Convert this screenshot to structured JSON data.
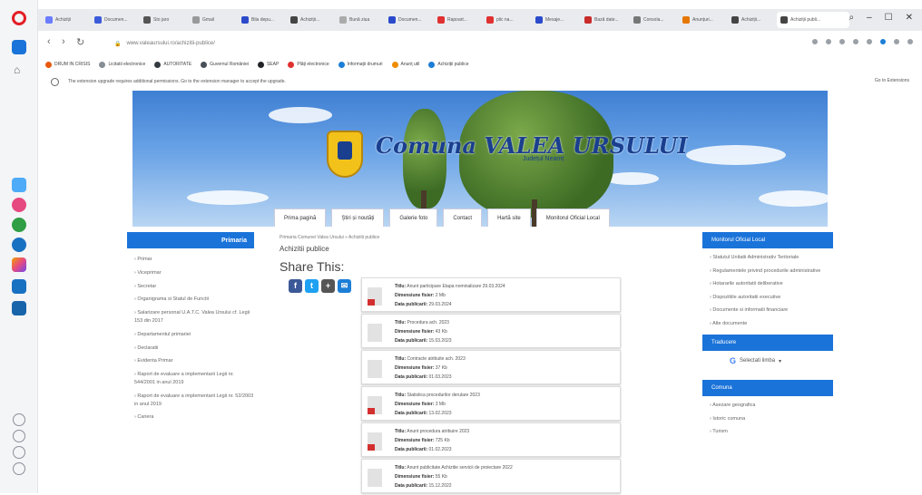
{
  "browser": {
    "tabs": [
      {
        "label": "Achiziții",
        "color": "#6b7cff"
      },
      {
        "label": "Documen...",
        "color": "#3b5bdb"
      },
      {
        "label": "Sto jaro",
        "color": "#555555"
      },
      {
        "label": "Gmail",
        "color": "#999999"
      },
      {
        "label": "Bila depu...",
        "color": "#2b4acb"
      },
      {
        "label": "Achiziții...",
        "color": "#444444"
      },
      {
        "label": "Bună ziua",
        "color": "#aaaaaa"
      },
      {
        "label": "Documen...",
        "color": "#2b4acb"
      },
      {
        "label": "Rapoart...",
        "color": "#e03131"
      },
      {
        "label": "plic na...",
        "color": "#e03131"
      },
      {
        "label": "Mesaje...",
        "color": "#2b4acb"
      },
      {
        "label": "Bază date...",
        "color": "#c92a2a"
      },
      {
        "label": "Consola...",
        "color": "#777777"
      },
      {
        "label": "Anunțuri...",
        "color": "#e67700"
      },
      {
        "label": "Achiziții...",
        "color": "#444444"
      },
      {
        "label": "Achiziții publi...",
        "color": "#444444",
        "active": true
      }
    ],
    "url": "www.valeaursului.ro/achizitii-publice/",
    "bookmarks": [
      {
        "label": "DRUM IN CRISIS",
        "color": "#e8590c"
      },
      {
        "label": "Licitatii electronice",
        "color": "#868e96"
      },
      {
        "label": "AUTORITATE",
        "color": "#343a40"
      },
      {
        "label": "Guvernul României",
        "color": "#495057"
      },
      {
        "label": "SEAP",
        "color": "#212529"
      },
      {
        "label": "Plăți electronice",
        "color": "#e03131"
      },
      {
        "label": "Informații drumuri",
        "color": "#1c7ed6"
      },
      {
        "label": "Anunț util",
        "color": "#f08c00"
      },
      {
        "label": "Achiziții publice",
        "color": "#1c7ed6"
      }
    ],
    "infobar_text": "The extension upgrade requires additional permissions. Go to the extension manager to accept the upgrade.",
    "infobar_action": "Go to Extensions"
  },
  "site": {
    "title": "Comuna VALEA URSULUI",
    "subtitle": "Județul Neamț",
    "menu": [
      "Prima pagină",
      "Știri și noutăți",
      "Galerie foto",
      "Contact",
      "Hartă site",
      "Monitorul Oficial Local"
    ],
    "left_header": "Primaria",
    "left_items": [
      "Primar",
      "Viceprimar",
      "Secretar",
      "Organigrama si Statul de Functii",
      "Salarizare personal U.A.T.C. Valea Ursului cf. Legii 153 din 2017",
      "Departamentul primariei",
      "Declaratii",
      "Evidenta Primar",
      "Raport de evaluare a implementarii Legii nr. 544/2001 in anul 2019",
      "Raport de evaluare a implementarii Legii nr. 52/2003 in anul 2019",
      "Cariera"
    ],
    "breadcrumb": "Primaria Comunei Valea Ursului » Achizitii publice",
    "page_title": "Achizitii publice",
    "share_title": "Share This:",
    "docs": [
      {
        "title": "Anunt participare Etapa nominalizare 29.03.2024",
        "size": "2 Mb",
        "date": "29.03.2024",
        "pdf": true
      },
      {
        "title": "Procedura ach. 2023",
        "size": "43 Kb",
        "date": "15.03.2023",
        "pdf": false
      },
      {
        "title": "Contracte atribuite ach. 2023",
        "size": "37 Kb",
        "date": "01.03.2023",
        "pdf": false
      },
      {
        "title": "Statistica procedurilor derulare 2023",
        "size": "3 Mb",
        "date": "13.02.2023",
        "pdf": true
      },
      {
        "title": "Anunt procedura atribuire 2023",
        "size": "725 Kb",
        "date": "01.02.2023",
        "pdf": true
      },
      {
        "title": "Anunt publicitate Achizitie servicii de proiectare 2022",
        "size": "55 Kb",
        "date": "15.12.2022",
        "pdf": false
      }
    ],
    "doc_labels": {
      "title": "Titlu:",
      "size": "Dimensiune fisier:",
      "date": "Data publicarii:"
    },
    "right_header": "Monitorul Oficial Local",
    "right_items": [
      "Statutul Unitatii Administrativ Teritoriale",
      "Regulamentele privind procedurile administrative",
      "Hotararile autoritatii deliberative",
      "Dispozitiile autoritatii executive",
      "Documente si informatii financiare",
      "Alte documente"
    ],
    "translate_header": "Traducere",
    "translate_label": "Selectati limba",
    "comuna_header": "Comuna",
    "comuna_items": [
      "Asezare geografica",
      "Istoric comuna",
      "Turism"
    ]
  }
}
